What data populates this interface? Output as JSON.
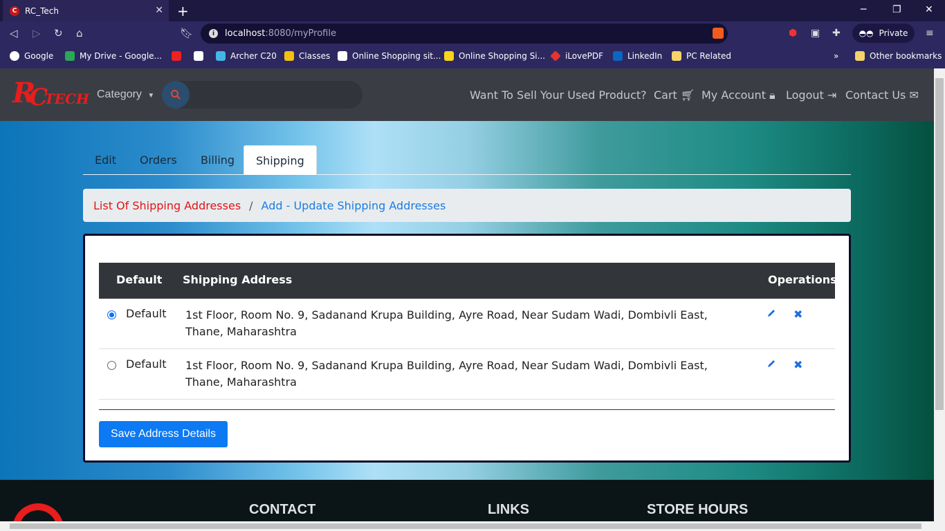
{
  "browser": {
    "tab_title": "RC_Tech",
    "url_host": "localhost",
    "url_path": ":8080/myProfile",
    "private_label": "Private",
    "brave_count": "2",
    "bookmarks": [
      "Google",
      "My Drive - Google...",
      "Archer C20",
      "Classes",
      "Online Shopping sit...",
      "Online Shopping Si...",
      "iLovePDF",
      "LinkedIn",
      "PC Related",
      "Other bookmarks"
    ],
    "more_chevron": "»"
  },
  "nav": {
    "logo_r": "R",
    "logo_c": "C",
    "logo_tech": "TECH",
    "category": "Category",
    "links": [
      "Want To Sell Your Used Product?",
      "Cart",
      "My Account",
      "Logout",
      "Contact Us"
    ]
  },
  "profile_tabs": [
    "Edit",
    "Orders",
    "Billing",
    "Shipping"
  ],
  "active_tab": "Shipping",
  "breadcrumb": {
    "item1": "List Of Shipping Addresses",
    "separator": "/",
    "item2": "Add - Update Shipping Addresses"
  },
  "table": {
    "headers": [
      "Default",
      "Shipping Address",
      "Operations"
    ],
    "rows": [
      {
        "default_label": "Default",
        "selected": true,
        "address": "1st Floor, Room No. 9, Sadanand Krupa Building, Ayre Road, Near Sudam Wadi, Dombivli East, Thane, Maharashtra"
      },
      {
        "default_label": "Default",
        "selected": false,
        "address": "1st Floor, Room No. 9, Sadanand Krupa Building, Ayre Road, Near Sudam Wadi, Dombivli East, Thane, Maharashtra"
      }
    ]
  },
  "save_button": "Save Address Details",
  "footer": {
    "headings": [
      "CONTACT",
      "LINKS",
      "STORE HOURS"
    ]
  },
  "colors": {
    "accent": "#0d79f2",
    "brand_red": "#e81d1d",
    "nav_bg": "#3a3e44"
  }
}
